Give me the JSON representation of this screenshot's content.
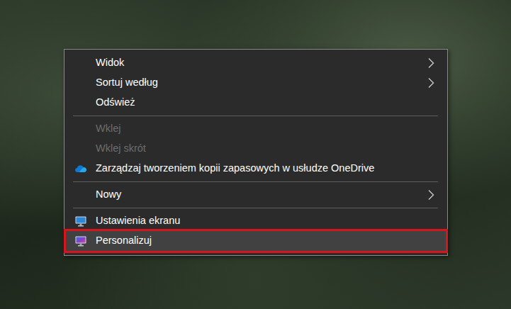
{
  "menu": {
    "groups": [
      [
        {
          "label": "Widok",
          "kind": "submenu",
          "disabled": false,
          "selected": false
        },
        {
          "label": "Sortuj według",
          "kind": "submenu",
          "disabled": false,
          "selected": false
        },
        {
          "label": "Odśwież",
          "kind": "plain",
          "disabled": false,
          "selected": false
        }
      ],
      [
        {
          "label": "Wklej",
          "kind": "plain",
          "disabled": true,
          "selected": false
        },
        {
          "label": "Wklej skrót",
          "kind": "plain",
          "disabled": true,
          "selected": false
        },
        {
          "label": "Zarządzaj tworzeniem kopii zapasowych w usłudze OneDrive",
          "kind": "onedrive",
          "disabled": false,
          "selected": false
        }
      ],
      [
        {
          "label": "Nowy",
          "kind": "submenu",
          "disabled": false,
          "selected": false
        }
      ],
      [
        {
          "label": "Ustawienia ekranu",
          "kind": "display",
          "disabled": false,
          "selected": false
        },
        {
          "label": "Personalizuj",
          "kind": "personalize",
          "disabled": false,
          "selected": true
        }
      ]
    ]
  }
}
